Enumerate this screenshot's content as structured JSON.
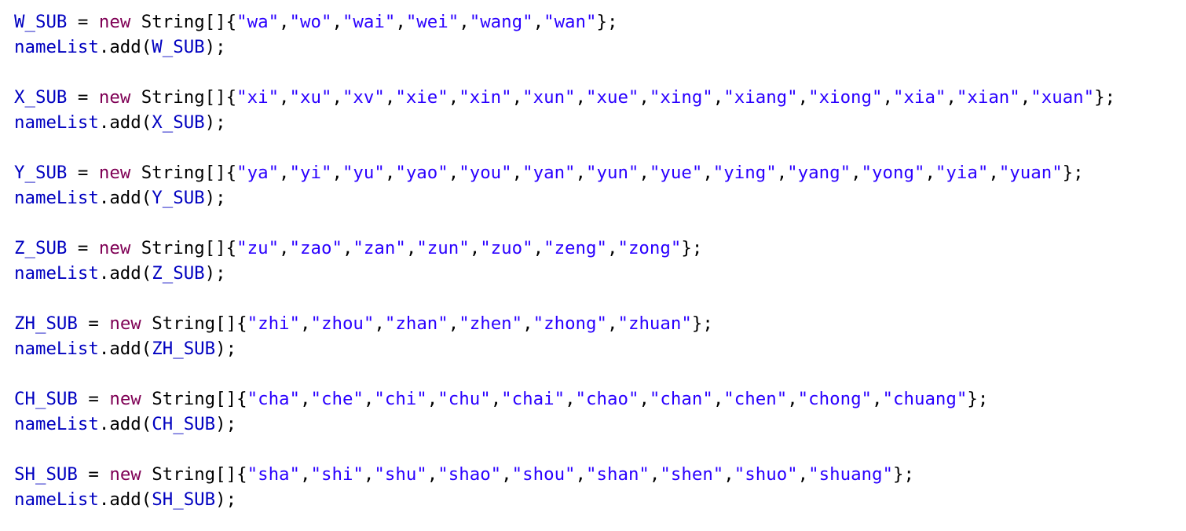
{
  "colors": {
    "background": "#FFFFFF",
    "field": "#0000C0",
    "keyword": "#7F0055",
    "string": "#2A00FF",
    "plain": "#000000"
  },
  "code_lines": [
    [
      {
        "t": "W_SUB",
        "k": "field"
      },
      {
        "t": " = ",
        "k": "plain"
      },
      {
        "t": "new",
        "k": "keyword"
      },
      {
        "t": " String[]{",
        "k": "plain"
      },
      {
        "t": "\"wa\"",
        "k": "string"
      },
      {
        "t": ",",
        "k": "plain"
      },
      {
        "t": "\"wo\"",
        "k": "string"
      },
      {
        "t": ",",
        "k": "plain"
      },
      {
        "t": "\"wai\"",
        "k": "string"
      },
      {
        "t": ",",
        "k": "plain"
      },
      {
        "t": "\"wei\"",
        "k": "string"
      },
      {
        "t": ",",
        "k": "plain"
      },
      {
        "t": "\"wang\"",
        "k": "string"
      },
      {
        "t": ",",
        "k": "plain"
      },
      {
        "t": "\"wan\"",
        "k": "string"
      },
      {
        "t": "};",
        "k": "plain"
      }
    ],
    [
      {
        "t": "nameList",
        "k": "field"
      },
      {
        "t": ".add(",
        "k": "plain"
      },
      {
        "t": "W_SUB",
        "k": "field"
      },
      {
        "t": ");",
        "k": "plain"
      }
    ],
    [],
    [
      {
        "t": "X_SUB",
        "k": "field"
      },
      {
        "t": " = ",
        "k": "plain"
      },
      {
        "t": "new",
        "k": "keyword"
      },
      {
        "t": " String[]{",
        "k": "plain"
      },
      {
        "t": "\"xi\"",
        "k": "string"
      },
      {
        "t": ",",
        "k": "plain"
      },
      {
        "t": "\"xu\"",
        "k": "string"
      },
      {
        "t": ",",
        "k": "plain"
      },
      {
        "t": "\"xv\"",
        "k": "string"
      },
      {
        "t": ",",
        "k": "plain"
      },
      {
        "t": "\"xie\"",
        "k": "string"
      },
      {
        "t": ",",
        "k": "plain"
      },
      {
        "t": "\"xin\"",
        "k": "string"
      },
      {
        "t": ",",
        "k": "plain"
      },
      {
        "t": "\"xun\"",
        "k": "string"
      },
      {
        "t": ",",
        "k": "plain"
      },
      {
        "t": "\"xue\"",
        "k": "string"
      },
      {
        "t": ",",
        "k": "plain"
      },
      {
        "t": "\"xing\"",
        "k": "string"
      },
      {
        "t": ",",
        "k": "plain"
      },
      {
        "t": "\"xiang\"",
        "k": "string"
      },
      {
        "t": ",",
        "k": "plain"
      },
      {
        "t": "\"xiong\"",
        "k": "string"
      },
      {
        "t": ",",
        "k": "plain"
      },
      {
        "t": "\"xia\"",
        "k": "string"
      },
      {
        "t": ",",
        "k": "plain"
      },
      {
        "t": "\"xian\"",
        "k": "string"
      },
      {
        "t": ",",
        "k": "plain"
      },
      {
        "t": "\"xuan\"",
        "k": "string"
      },
      {
        "t": "};",
        "k": "plain"
      }
    ],
    [
      {
        "t": "nameList",
        "k": "field"
      },
      {
        "t": ".add(",
        "k": "plain"
      },
      {
        "t": "X_SUB",
        "k": "field"
      },
      {
        "t": ");",
        "k": "plain"
      }
    ],
    [],
    [
      {
        "t": "Y_SUB",
        "k": "field"
      },
      {
        "t": " = ",
        "k": "plain"
      },
      {
        "t": "new",
        "k": "keyword"
      },
      {
        "t": " String[]{",
        "k": "plain"
      },
      {
        "t": "\"ya\"",
        "k": "string"
      },
      {
        "t": ",",
        "k": "plain"
      },
      {
        "t": "\"yi\"",
        "k": "string"
      },
      {
        "t": ",",
        "k": "plain"
      },
      {
        "t": "\"yu\"",
        "k": "string"
      },
      {
        "t": ",",
        "k": "plain"
      },
      {
        "t": "\"yao\"",
        "k": "string"
      },
      {
        "t": ",",
        "k": "plain"
      },
      {
        "t": "\"you\"",
        "k": "string"
      },
      {
        "t": ",",
        "k": "plain"
      },
      {
        "t": "\"yan\"",
        "k": "string"
      },
      {
        "t": ",",
        "k": "plain"
      },
      {
        "t": "\"yun\"",
        "k": "string"
      },
      {
        "t": ",",
        "k": "plain"
      },
      {
        "t": "\"yue\"",
        "k": "string"
      },
      {
        "t": ",",
        "k": "plain"
      },
      {
        "t": "\"ying\"",
        "k": "string"
      },
      {
        "t": ",",
        "k": "plain"
      },
      {
        "t": "\"yang\"",
        "k": "string"
      },
      {
        "t": ",",
        "k": "plain"
      },
      {
        "t": "\"yong\"",
        "k": "string"
      },
      {
        "t": ",",
        "k": "plain"
      },
      {
        "t": "\"yia\"",
        "k": "string"
      },
      {
        "t": ",",
        "k": "plain"
      },
      {
        "t": "\"yuan\"",
        "k": "string"
      },
      {
        "t": "};",
        "k": "plain"
      }
    ],
    [
      {
        "t": "nameList",
        "k": "field"
      },
      {
        "t": ".add(",
        "k": "plain"
      },
      {
        "t": "Y_SUB",
        "k": "field"
      },
      {
        "t": ");",
        "k": "plain"
      }
    ],
    [],
    [
      {
        "t": "Z_SUB",
        "k": "field"
      },
      {
        "t": " = ",
        "k": "plain"
      },
      {
        "t": "new",
        "k": "keyword"
      },
      {
        "t": " String[]{",
        "k": "plain"
      },
      {
        "t": "\"zu\"",
        "k": "string"
      },
      {
        "t": ",",
        "k": "plain"
      },
      {
        "t": "\"zao\"",
        "k": "string"
      },
      {
        "t": ",",
        "k": "plain"
      },
      {
        "t": "\"zan\"",
        "k": "string"
      },
      {
        "t": ",",
        "k": "plain"
      },
      {
        "t": "\"zun\"",
        "k": "string"
      },
      {
        "t": ",",
        "k": "plain"
      },
      {
        "t": "\"zuo\"",
        "k": "string"
      },
      {
        "t": ",",
        "k": "plain"
      },
      {
        "t": "\"zeng\"",
        "k": "string"
      },
      {
        "t": ",",
        "k": "plain"
      },
      {
        "t": "\"zong\"",
        "k": "string"
      },
      {
        "t": "};",
        "k": "plain"
      }
    ],
    [
      {
        "t": "nameList",
        "k": "field"
      },
      {
        "t": ".add(",
        "k": "plain"
      },
      {
        "t": "Z_SUB",
        "k": "field"
      },
      {
        "t": ");",
        "k": "plain"
      }
    ],
    [],
    [
      {
        "t": "ZH_SUB",
        "k": "field"
      },
      {
        "t": " = ",
        "k": "plain"
      },
      {
        "t": "new",
        "k": "keyword"
      },
      {
        "t": " String[]{",
        "k": "plain"
      },
      {
        "t": "\"zhi\"",
        "k": "string"
      },
      {
        "t": ",",
        "k": "plain"
      },
      {
        "t": "\"zhou\"",
        "k": "string"
      },
      {
        "t": ",",
        "k": "plain"
      },
      {
        "t": "\"zhan\"",
        "k": "string"
      },
      {
        "t": ",",
        "k": "plain"
      },
      {
        "t": "\"zhen\"",
        "k": "string"
      },
      {
        "t": ",",
        "k": "plain"
      },
      {
        "t": "\"zhong\"",
        "k": "string"
      },
      {
        "t": ",",
        "k": "plain"
      },
      {
        "t": "\"zhuan\"",
        "k": "string"
      },
      {
        "t": "};",
        "k": "plain"
      }
    ],
    [
      {
        "t": "nameList",
        "k": "field"
      },
      {
        "t": ".add(",
        "k": "plain"
      },
      {
        "t": "ZH_SUB",
        "k": "field"
      },
      {
        "t": ");",
        "k": "plain"
      }
    ],
    [],
    [
      {
        "t": "CH_SUB",
        "k": "field"
      },
      {
        "t": " = ",
        "k": "plain"
      },
      {
        "t": "new",
        "k": "keyword"
      },
      {
        "t": " String[]{",
        "k": "plain"
      },
      {
        "t": "\"cha\"",
        "k": "string"
      },
      {
        "t": ",",
        "k": "plain"
      },
      {
        "t": "\"che\"",
        "k": "string"
      },
      {
        "t": ",",
        "k": "plain"
      },
      {
        "t": "\"chi\"",
        "k": "string"
      },
      {
        "t": ",",
        "k": "plain"
      },
      {
        "t": "\"chu\"",
        "k": "string"
      },
      {
        "t": ",",
        "k": "plain"
      },
      {
        "t": "\"chai\"",
        "k": "string"
      },
      {
        "t": ",",
        "k": "plain"
      },
      {
        "t": "\"chao\"",
        "k": "string"
      },
      {
        "t": ",",
        "k": "plain"
      },
      {
        "t": "\"chan\"",
        "k": "string"
      },
      {
        "t": ",",
        "k": "plain"
      },
      {
        "t": "\"chen\"",
        "k": "string"
      },
      {
        "t": ",",
        "k": "plain"
      },
      {
        "t": "\"chong\"",
        "k": "string"
      },
      {
        "t": ",",
        "k": "plain"
      },
      {
        "t": "\"chuang\"",
        "k": "string"
      },
      {
        "t": "};",
        "k": "plain"
      }
    ],
    [
      {
        "t": "nameList",
        "k": "field"
      },
      {
        "t": ".add(",
        "k": "plain"
      },
      {
        "t": "CH_SUB",
        "k": "field"
      },
      {
        "t": ");",
        "k": "plain"
      }
    ],
    [],
    [
      {
        "t": "SH_SUB",
        "k": "field"
      },
      {
        "t": " = ",
        "k": "plain"
      },
      {
        "t": "new",
        "k": "keyword"
      },
      {
        "t": " String[]{",
        "k": "plain"
      },
      {
        "t": "\"sha\"",
        "k": "string"
      },
      {
        "t": ",",
        "k": "plain"
      },
      {
        "t": "\"shi\"",
        "k": "string"
      },
      {
        "t": ",",
        "k": "plain"
      },
      {
        "t": "\"shu\"",
        "k": "string"
      },
      {
        "t": ",",
        "k": "plain"
      },
      {
        "t": "\"shao\"",
        "k": "string"
      },
      {
        "t": ",",
        "k": "plain"
      },
      {
        "t": "\"shou\"",
        "k": "string"
      },
      {
        "t": ",",
        "k": "plain"
      },
      {
        "t": "\"shan\"",
        "k": "string"
      },
      {
        "t": ",",
        "k": "plain"
      },
      {
        "t": "\"shen\"",
        "k": "string"
      },
      {
        "t": ",",
        "k": "plain"
      },
      {
        "t": "\"shuo\"",
        "k": "string"
      },
      {
        "t": ",",
        "k": "plain"
      },
      {
        "t": "\"shuang\"",
        "k": "string"
      },
      {
        "t": "};",
        "k": "plain"
      }
    ],
    [
      {
        "t": "nameList",
        "k": "field"
      },
      {
        "t": ".add(",
        "k": "plain"
      },
      {
        "t": "SH_SUB",
        "k": "field"
      },
      {
        "t": ");",
        "k": "plain"
      }
    ]
  ]
}
